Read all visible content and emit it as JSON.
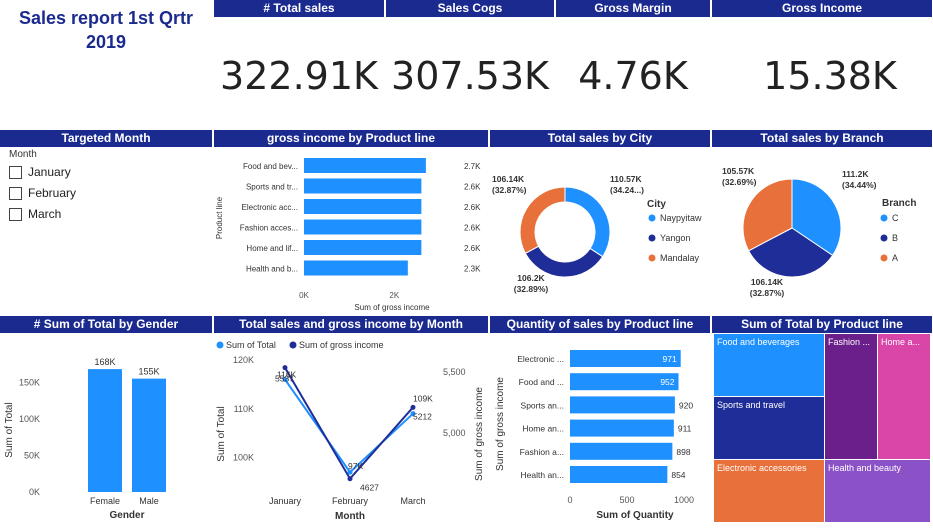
{
  "report_title": "Sales report 1st Qrtr 2019",
  "kpis": [
    {
      "label": "# Total sales",
      "value": "322.91K"
    },
    {
      "label": "Sales Cogs",
      "value": "307.53K"
    },
    {
      "label": "Gross Margin",
      "value": "4.76K"
    },
    {
      "label": "Gross Income",
      "value": "15.38K"
    }
  ],
  "slicer": {
    "header": "Targeted Month",
    "field": "Month",
    "options": [
      "January",
      "February",
      "March"
    ]
  },
  "colors": {
    "navy": "#1b2a8f",
    "blue": "#1e90ff",
    "dark_blue": "#1f2d98",
    "orange": "#e8703a",
    "purple": "#6a1f8a",
    "pink": "#d946a8",
    "violet": "#8b52c8"
  },
  "chart_data": [
    {
      "id": "gross_income_by_product_line",
      "type": "bar",
      "orientation": "horizontal",
      "title": "gross income by Product line",
      "ylabel": "Product line",
      "xlabel": "Sum of gross income",
      "categories": [
        "Food and bev...",
        "Sports and tr...",
        "Electronic acc...",
        "Fashion acces...",
        "Home and lif...",
        "Health and b..."
      ],
      "values": [
        2700,
        2600,
        2600,
        2600,
        2600,
        2300
      ],
      "data_labels": [
        "2.7K",
        "2.6K",
        "2.6K",
        "2.6K",
        "2.6K",
        "2.3K"
      ],
      "xticks": [
        "0K",
        "2K"
      ],
      "xlim": [
        0,
        3500
      ]
    },
    {
      "id": "total_sales_by_city",
      "type": "pie",
      "donut": true,
      "title": "Total sales by City",
      "legend_title": "City",
      "legend_position": "right",
      "slices": [
        {
          "name": "Naypyitaw",
          "value": 110.57,
          "label": "110.57K",
          "pct": "(34.24...)",
          "color": "#1e90ff"
        },
        {
          "name": "Yangon",
          "value": 106.2,
          "label": "106.2K",
          "pct": "(32.89%)",
          "color": "#1f2d98"
        },
        {
          "name": "Mandalay",
          "value": 106.14,
          "label": "106.14K",
          "pct": "(32.87%)",
          "color": "#e8703a"
        }
      ]
    },
    {
      "id": "total_sales_by_branch",
      "type": "pie",
      "donut": false,
      "title": "Total sales by Branch",
      "legend_title": "Branch",
      "legend_position": "right",
      "slices": [
        {
          "name": "C",
          "value": 111.2,
          "label": "111.2K",
          "pct": "(34.44%)",
          "color": "#1e90ff"
        },
        {
          "name": "B",
          "value": 106.14,
          "label": "106.14K",
          "pct": "(32.87%)",
          "color": "#1f2d98"
        },
        {
          "name": "A",
          "value": 105.57,
          "label": "105.57K",
          "pct": "(32.69%)",
          "color": "#e8703a"
        }
      ]
    },
    {
      "id": "sum_of_total_by_gender",
      "type": "bar",
      "orientation": "vertical",
      "title": "# Sum of Total by Gender",
      "xlabel": "Gender",
      "ylabel": "Sum of Total",
      "categories": [
        "Female",
        "Male"
      ],
      "values": [
        168,
        155
      ],
      "data_labels": [
        "168K",
        "155K"
      ],
      "yticks": [
        "0K",
        "50K",
        "100K",
        "150K"
      ],
      "ylim": [
        0,
        175
      ]
    },
    {
      "id": "total_sales_and_gross_income_by_month",
      "type": "line",
      "title": "Total sales and gross income by Month",
      "xlabel": "Month",
      "ylabel": "Sum of Total",
      "y2label": "Sum of gross income",
      "legend_position": "top-left",
      "categories": [
        "January",
        "February",
        "March"
      ],
      "series": [
        {
          "name": "Sum of Total",
          "values": [
            116,
            97,
            109
          ],
          "labels": [
            "116K",
            "97K",
            "109K"
          ],
          "color": "#1e90ff",
          "axis": "left"
        },
        {
          "name": "Sum of gross income",
          "values": [
            5537,
            4627,
            5212
          ],
          "labels": [
            "5537",
            "4627",
            "5212"
          ],
          "color": "#1f2d98",
          "axis": "right"
        }
      ],
      "yticks": [
        "100K",
        "110K",
        "120K"
      ],
      "ylim": [
        95,
        120
      ],
      "y2ticks": [
        "5,000",
        "5,500"
      ],
      "y2lim": [
        4600,
        5600
      ]
    },
    {
      "id": "quantity_of_sales_by_product_line",
      "type": "bar",
      "orientation": "horizontal",
      "title": "Quantity of sales by Product line",
      "ylabel": "Sum of gross income",
      "xlabel": "Sum of Quantity",
      "categories": [
        "Electronic ...",
        "Food and ...",
        "Sports an...",
        "Home an...",
        "Fashion a...",
        "Health an..."
      ],
      "values": [
        971,
        952,
        920,
        911,
        898,
        854
      ],
      "data_labels": [
        "971",
        "952",
        "920",
        "911",
        "898",
        "854"
      ],
      "xticks": [
        "0",
        "500",
        "1000"
      ],
      "xlim": [
        0,
        1000
      ]
    },
    {
      "id": "sum_of_total_by_product_line",
      "type": "heatmap",
      "subtype": "treemap",
      "title": "Sum of Total by Product line",
      "tiles": [
        {
          "name": "Food and beverages",
          "color": "#1e90ff"
        },
        {
          "name": "Sports and travel",
          "color": "#1f2d98"
        },
        {
          "name": "Electronic accessories",
          "color": "#e8703a"
        },
        {
          "name": "Fashion ...",
          "color": "#6a1f8a"
        },
        {
          "name": "Home a...",
          "color": "#d946a8"
        },
        {
          "name": "Health and beauty",
          "color": "#8b52c8"
        }
      ]
    }
  ]
}
